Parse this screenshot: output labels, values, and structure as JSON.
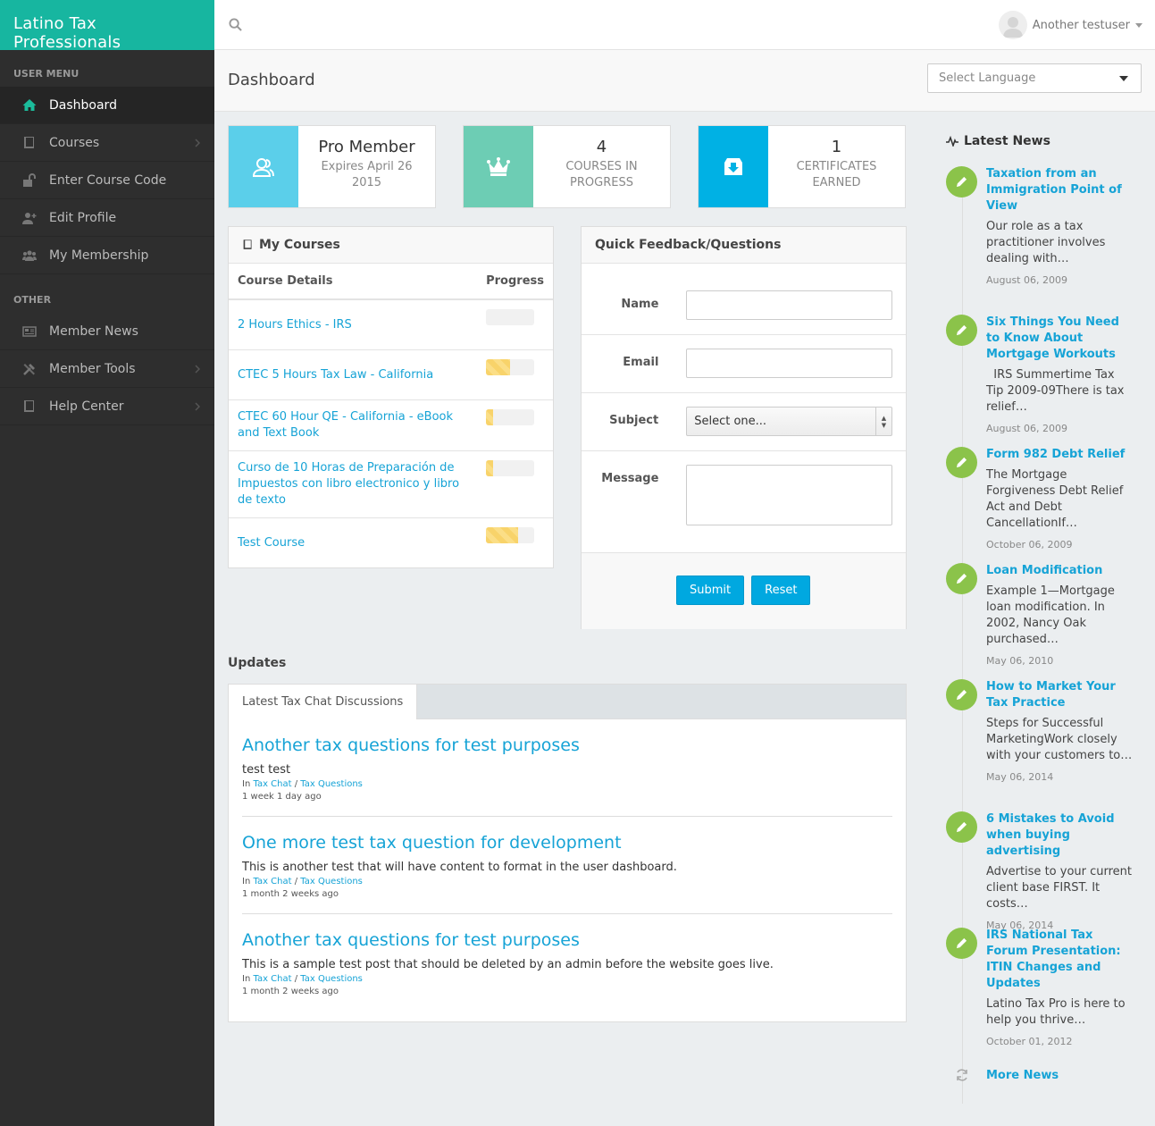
{
  "brand": "Latino Tax Professionals",
  "user_name": "Another testuser",
  "page_title": "Dashboard",
  "language_select": "Select Language",
  "sidebar": {
    "user_menu_label": "USER MENU",
    "other_label": "OTHER",
    "items": [
      {
        "label": "Dashboard",
        "icon": "home-icon"
      },
      {
        "label": "Courses",
        "icon": "book-icon"
      },
      {
        "label": "Enter Course Code",
        "icon": "unlock-icon"
      },
      {
        "label": "Edit Profile",
        "icon": "user-plus-icon"
      },
      {
        "label": "My Membership",
        "icon": "users-icon"
      },
      {
        "label": "Member News",
        "icon": "newspaper-icon"
      },
      {
        "label": "Member Tools",
        "icon": "tools-icon"
      },
      {
        "label": "Help Center",
        "icon": "book-icon"
      }
    ]
  },
  "stats": {
    "membership": {
      "title": "Pro Member",
      "subtitle": "Expires April 26 2015",
      "color": "#5bcfea"
    },
    "courses": {
      "value": "4",
      "label": "COURSES IN PROGRESS",
      "color": "#6dcdb4"
    },
    "certificates": {
      "value": "1",
      "label": "CERTIFICATES EARNED",
      "color": "#00b1e4"
    }
  },
  "my_courses": {
    "title": "My Courses",
    "col_details": "Course Details",
    "col_progress": "Progress",
    "rows": [
      {
        "name": "2 Hours Ethics - IRS",
        "progress": 0
      },
      {
        "name": "CTEC 5 Hours Tax Law - California",
        "progress": 50
      },
      {
        "name": "CTEC 60 Hour QE - California - eBook and Text Book",
        "progress": 15
      },
      {
        "name": "Curso de 10 Horas de Preparación de Impuestos con libro electronico y libro de texto",
        "progress": 15
      },
      {
        "name": "Test Course",
        "progress": 67
      }
    ]
  },
  "feedback": {
    "title": "Quick Feedback/Questions",
    "name_label": "Name",
    "email_label": "Email",
    "subject_label": "Subject",
    "subject_value": "Select one...",
    "message_label": "Message",
    "submit": "Submit",
    "reset": "Reset"
  },
  "updates": {
    "title": "Updates",
    "tab": "Latest Tax Chat Discussions",
    "discussions": [
      {
        "title": "Another tax questions for test purposes",
        "body": "test test",
        "in": "In",
        "cat1": "Tax Chat",
        "sep": "/",
        "cat2": "Tax Questions",
        "time": "1 week 1 day ago"
      },
      {
        "title": "One more test tax question for development",
        "body": "This is another test that will have content to format in the user dashboard.",
        "in": "In",
        "cat1": "Tax Chat",
        "sep": "/",
        "cat2": "Tax Questions",
        "time": "1 month 2 weeks ago"
      },
      {
        "title": "Another tax questions for test purposes",
        "body": "This is a sample test post that should be deleted by an admin before the website goes live.",
        "in": "In",
        "cat1": "Tax Chat",
        "sep": "/",
        "cat2": "Tax Questions",
        "time": "1 month 2 weeks ago"
      }
    ]
  },
  "news": {
    "title": "Latest News",
    "more": "More News",
    "items": [
      {
        "title": "Taxation from an Immigration Point of View",
        "text": "Our role as a tax practitioner involves dealing with…",
        "date": "August 06, 2009"
      },
      {
        "title": "Six Things You Need to Know About Mortgage Workouts",
        "text": "  IRS Summertime Tax Tip 2009-09There is tax relief…",
        "date": "August 06, 2009"
      },
      {
        "title": "Form 982 Debt Relief",
        "text": "The Mortgage Forgiveness Debt Relief Act and Debt CancellationIf…",
        "date": "October 06, 2009"
      },
      {
        "title": "Loan Modification",
        "text": "Example 1—Mortgage loan modification. In 2002, Nancy Oak purchased…",
        "date": "May 06, 2010"
      },
      {
        "title": "How to Market Your Tax Practice",
        "text": "Steps for Successful MarketingWork closely with your customers to…",
        "date": "May 06, 2014"
      },
      {
        "title": "6 Mistakes to Avoid when buying advertising",
        "text": "Advertise to your current client base FIRST. It costs…",
        "date": "May 06, 2014"
      },
      {
        "title": "IRS National Tax Forum Presentation: ITIN Changes and Updates",
        "text": "Latino Tax Pro is here to help you thrive…",
        "date": "October 01, 2012"
      }
    ]
  }
}
